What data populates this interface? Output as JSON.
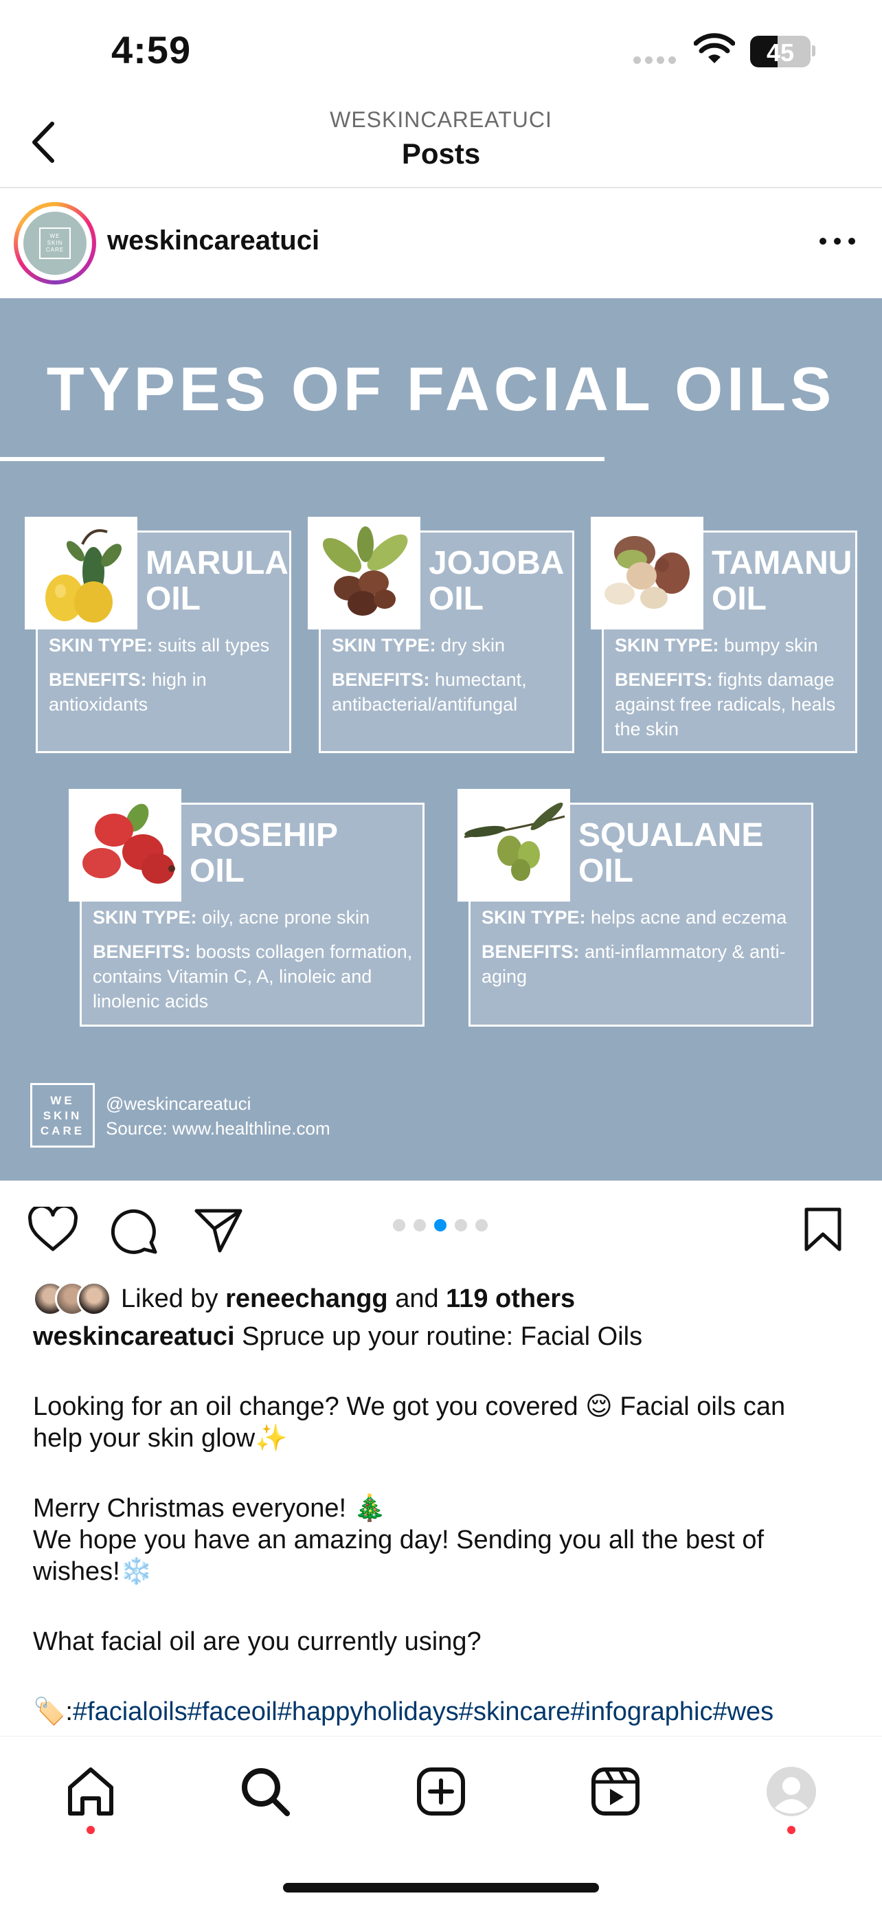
{
  "status_bar": {
    "time": "4:59",
    "battery": "45",
    "battery_level": 0.45
  },
  "header": {
    "account": "WESKINCAREATUCI",
    "title": "Posts"
  },
  "post": {
    "username": "weskincareatuci",
    "avatar_logo": [
      "WE",
      "SKIN",
      "CARE"
    ],
    "image": {
      "title": "TYPES OF FACIAL OILS",
      "oils": [
        {
          "name": [
            "MARULA",
            "OIL"
          ],
          "skin_type_label": "SKIN TYPE:",
          "skin_type": "suits all types",
          "benefits_label": "BENEFITS:",
          "benefits": "high in antioxidants"
        },
        {
          "name": [
            "JOJOBA",
            "OIL"
          ],
          "skin_type_label": "SKIN TYPE:",
          "skin_type": "dry skin",
          "benefits_label": "BENEFITS:",
          "benefits": "humectant, antibacterial/antifungal"
        },
        {
          "name": [
            "TAMANU",
            "OIL"
          ],
          "skin_type_label": "SKIN TYPE:",
          "skin_type": "bumpy skin",
          "benefits_label": "BENEFITS:",
          "benefits": "fights damage against free radicals, heals the skin"
        },
        {
          "name": [
            "ROSEHIP",
            "OIL"
          ],
          "skin_type_label": "SKIN TYPE:",
          "skin_type": "oily, acne prone skin",
          "benefits_label": "BENEFITS:",
          "benefits": "boosts collagen formation, contains Vitamin C, A, linoleic and linolenic acids"
        },
        {
          "name": [
            "SQUALANE",
            "OIL"
          ],
          "skin_type_label": "SKIN TYPE:",
          "skin_type": "helps acne and eczema",
          "benefits_label": "BENEFITS:",
          "benefits": "anti-inflammatory & anti-aging"
        }
      ],
      "logo": [
        "WE",
        "SKIN",
        "CARE"
      ],
      "handle": "@weskincareatuci",
      "source": "Source: www.healthline.com"
    },
    "carousel": {
      "count": 5,
      "active": 3
    },
    "likes": {
      "prefix": "Liked by",
      "user": "reneechangg",
      "middle": "and",
      "others": "119 others"
    },
    "caption": {
      "username": "weskincareatuci",
      "headline": "Spruce up your routine: Facial Oils",
      "p1": "Looking for an oil change? We got you covered 😌 Facial oils can",
      "p1b": "help your skin glow✨",
      "p2": "Merry Christmas everyone! 🎄",
      "p3": "We hope you have an amazing day! Sending you all the best of",
      "p3b": "wishes!❄️",
      "p4": "What facial oil are you currently using?",
      "tags_prefix": "🏷️:",
      "tags": "#facialoils#faceoil#happyholidays#skincare#infographic#wes"
    }
  },
  "colors": {
    "image_bg": "#93a9be",
    "card_bg": "#a7b8ca",
    "link": "#00376b",
    "active_dot": "#0095f6",
    "notification_dot": "#ff3040"
  },
  "icons": {
    "header": [
      "back-chevron-icon"
    ],
    "actions": [
      "heart-icon",
      "comment-icon",
      "share-icon",
      "bookmark-icon",
      "more-icon"
    ],
    "tabs": [
      "home-icon",
      "search-icon",
      "create-icon",
      "reels-icon",
      "profile-icon"
    ]
  }
}
